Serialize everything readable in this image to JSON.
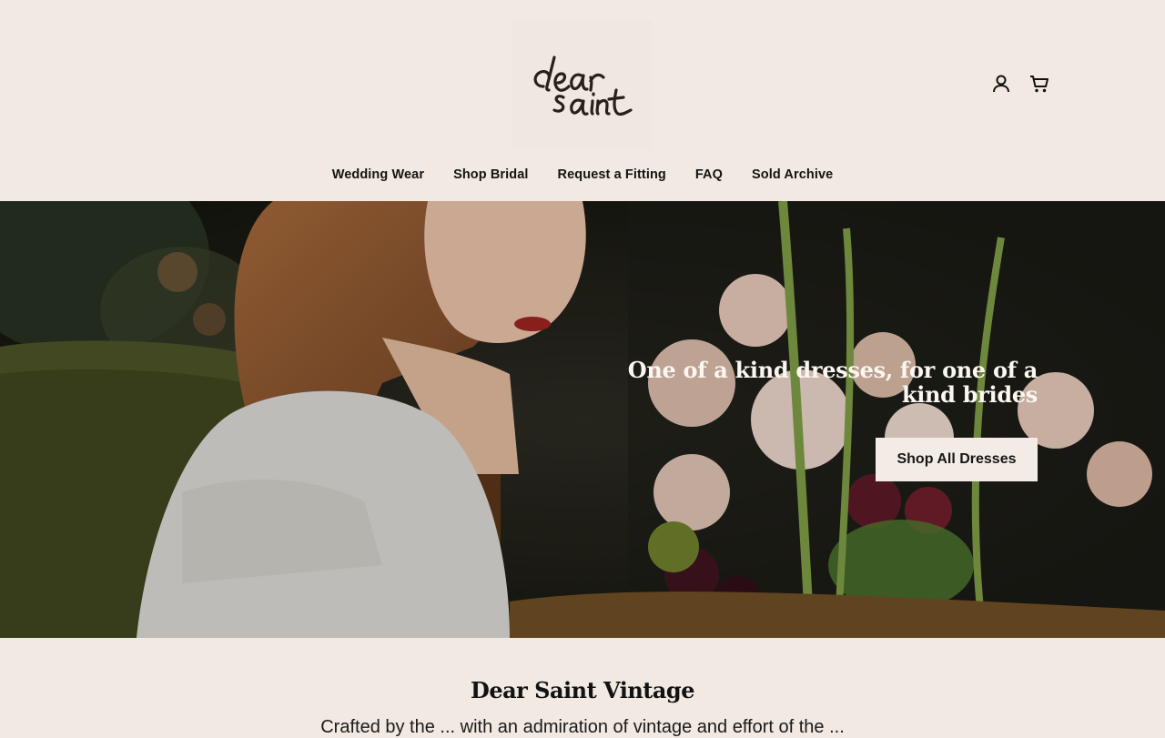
{
  "brand": {
    "logo_text": "dear saint"
  },
  "header": {
    "icons": [
      {
        "name": "account-icon"
      },
      {
        "name": "cart-icon"
      }
    ]
  },
  "nav": {
    "items": [
      {
        "label": "Wedding Wear"
      },
      {
        "label": "Shop Bridal"
      },
      {
        "label": "Request a Fitting"
      },
      {
        "label": "FAQ"
      },
      {
        "label": "Sold Archive"
      }
    ]
  },
  "hero": {
    "heading": "One of a kind dresses, for one of a kind brides",
    "cta_label": "Shop All Dresses"
  },
  "intro": {
    "title": "Dear Saint Vintage",
    "text": "Crafted by the ... with an admiration of vintage and effort of the ..."
  },
  "colors": {
    "background": "#f1e9e2",
    "text": "#111111",
    "button_bg": "#f3ece6"
  }
}
